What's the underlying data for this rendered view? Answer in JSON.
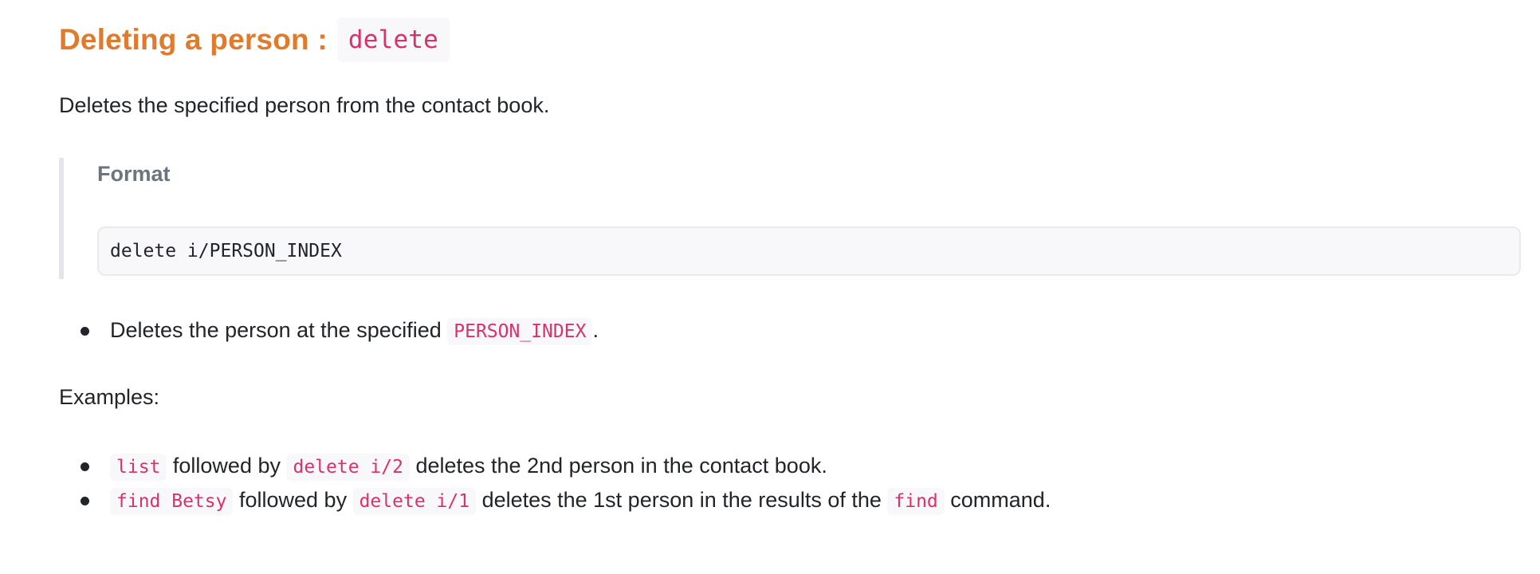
{
  "heading": {
    "title": "Deleting a person :",
    "command": "delete"
  },
  "description": "Deletes the specified person from the contact book.",
  "format": {
    "label": "Format",
    "code": "delete i/PERSON_INDEX"
  },
  "notes": [
    {
      "before": "Deletes the person at the specified ",
      "code": "PERSON_INDEX",
      "after": "."
    }
  ],
  "examples_label": "Examples:",
  "examples": [
    {
      "code1": "list",
      "text1": " followed by ",
      "code2": "delete i/2",
      "text2": " deletes the 2nd person in the contact book."
    },
    {
      "code1": "find Betsy",
      "text1": " followed by ",
      "code2": "delete i/1",
      "text2": " deletes the 1st person in the results of the ",
      "code3": "find",
      "text3": " command."
    }
  ],
  "colors": {
    "heading": "#e07b2e",
    "inline_code": "#d6336c",
    "quote_border": "#e3e5ea"
  }
}
